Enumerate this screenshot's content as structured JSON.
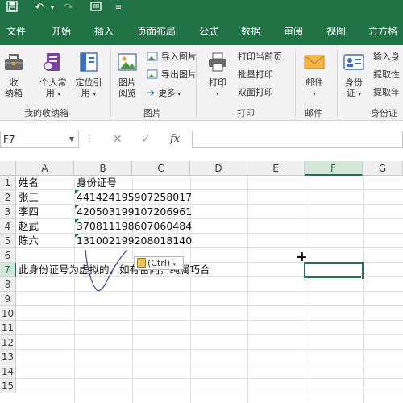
{
  "accent": "#217346",
  "titlebar": {
    "icons": [
      "save-icon",
      "undo-icon",
      "undo-dropdown-icon",
      "redo-icon",
      "quick-access-icon",
      "customize-icon"
    ]
  },
  "tabs": [
    "文件",
    "开始",
    "插入",
    "页面布局",
    "公式",
    "数据",
    "审阅",
    "视图",
    "方方格"
  ],
  "ribbon": {
    "group_my_box": {
      "label": "我的收纳箱",
      "btn_box_line1": "收",
      "btn_box_line2": "纳箱",
      "btn_personal_line1": "个人常",
      "btn_personal_line2": "用",
      "btn_locate_line1": "定位引",
      "btn_locate_line2": "用"
    },
    "group_picture": {
      "label": "图片",
      "btn_browse_line1": "图片",
      "btn_browse_line2": "阅览",
      "import": "导入图片",
      "export": "导出图片",
      "more": "更多"
    },
    "group_print": {
      "label": "打印",
      "btn_print": "打印",
      "print_current": "打印当前页",
      "batch_print": "批量打印",
      "duplex_print": "双面打印"
    },
    "group_mail": {
      "label": "邮件",
      "btn_mail": "邮件"
    },
    "group_id": {
      "label": "身份证",
      "btn_id_line1": "身份",
      "btn_id_line2": "证",
      "input_id": "输入身",
      "extract_gender": "提取性",
      "extract_age": "提取年"
    }
  },
  "formula_bar": {
    "name_box": "F7",
    "cancel_icon": "cancel-icon",
    "enter_icon": "enter-icon",
    "fx": "fx",
    "formula_value": ""
  },
  "grid": {
    "columns": [
      "A",
      "B",
      "C",
      "D",
      "E",
      "F",
      "G"
    ],
    "rows": [
      "1",
      "2",
      "3",
      "4",
      "5",
      "6",
      "7",
      "8",
      "9",
      "10",
      "11",
      "12",
      "13",
      "14",
      "15"
    ],
    "selected_cell": "F7",
    "cells": {
      "A1": "姓名",
      "B1": "身份证号",
      "A2": "张三",
      "B2": "441424195907258017",
      "A3": "李四",
      "B3": "420503199107206961",
      "A4": "赵武",
      "B4": "370811198607060484",
      "A5": "陈六",
      "B5": "131002199208018140",
      "A7": "此身份证号为虚拟的，如有雷同，纯属巧合"
    },
    "paste_options": "(Ctrl)"
  }
}
